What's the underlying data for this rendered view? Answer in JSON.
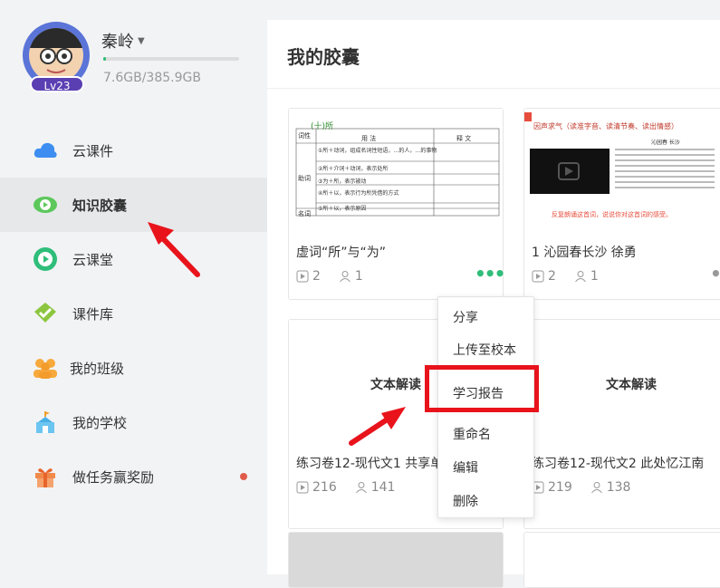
{
  "user": {
    "name": "秦岭",
    "level": "Lv23",
    "storage": "7.6GB/385.9GB",
    "storage_used_fraction": 0.02
  },
  "sidebar": {
    "items": [
      {
        "label": "云课件",
        "icon": "cloud-icon",
        "active": false
      },
      {
        "label": "知识胶囊",
        "icon": "capsule-icon",
        "active": true
      },
      {
        "label": "云课堂",
        "icon": "play-icon",
        "active": false
      },
      {
        "label": "课件库",
        "icon": "library-icon",
        "active": false
      },
      {
        "label": "我的班级",
        "icon": "class-icon",
        "active": false
      },
      {
        "label": "我的学校",
        "icon": "school-icon",
        "active": false
      },
      {
        "label": "做任务赢奖励",
        "icon": "gift-icon",
        "active": false,
        "badge_dot": true
      }
    ]
  },
  "main": {
    "title": "我的胶囊",
    "cards": [
      {
        "title": "虚词“所”与“为”",
        "plays": "2",
        "users": "1"
      },
      {
        "title": "1 沁园春长沙 徐勇",
        "plays": "2",
        "users": "1"
      },
      {
        "title": "练习卷12-现代文1 共享单",
        "plays": "216",
        "users": "141",
        "thumb_text": "文本解读"
      },
      {
        "title": "练习卷12-现代文2 此处忆江南",
        "plays": "219",
        "users": "138",
        "thumb_text": "文本解读"
      }
    ],
    "thumb1": {
      "heading": "(十)所",
      "col1": "词性",
      "col2": "用 法",
      "col3": "释 文",
      "rows": [
        "①所＋动词，组成名词性短语，…的人，…的事物",
        "②所＋介词＋动词，表示处所",
        "③为＋所，表示被动",
        "④所＋以，表示行为所凭借的方式",
        "⑤所＋以，表示原因"
      ],
      "side_label": "助词",
      "bottom_label": "名词"
    },
    "thumb2": {
      "top_text": "因声求气（读准字音、读清节奏、读出情感）",
      "poem_title": "沁园春 长沙",
      "bottom_text": "反复朗诵这首词，说说你对这首词的感受。"
    }
  },
  "context_menu": {
    "items": [
      "分享",
      "上传至校本",
      "学习报告",
      "重命名",
      "编辑",
      "删除"
    ],
    "highlighted": "学习报告"
  },
  "colors": {
    "accent_green": "#2fbe7a",
    "highlight_red": "#e8131b",
    "sidebar_bg": "#f2f3f5"
  }
}
